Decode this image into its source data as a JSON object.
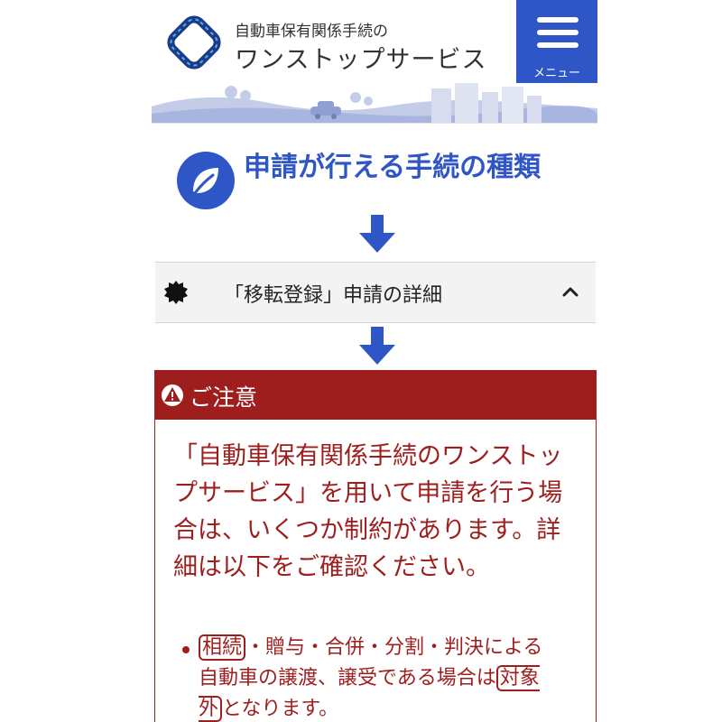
{
  "header": {
    "brand_line1": "自動車保有関係手続の",
    "brand_line2": "ワンストップサービス",
    "menu_label": "メニュー"
  },
  "section": {
    "title": "申請が行える手続の種類"
  },
  "accordion": {
    "label": "「移転登録」申請の詳細"
  },
  "notice": {
    "title": "ご注意",
    "body": "「自動車保有関係手続のワンストップサービス」を用いて申請を行う場合は、いくつか制約があります。詳細は以下をご確認ください。",
    "bullet": {
      "highlight1": "相続",
      "middle": "・贈与・合併・分割・判決による自動車の譲渡、譲受である場合は",
      "highlight2": "対象外",
      "end": "となります。"
    }
  },
  "colors": {
    "primary_blue": "#2f56c6",
    "notice_red": "#9e1e1e"
  },
  "icons": {
    "logo": "rounded-diamond-road-logo",
    "menu": "hamburger-icon",
    "section": "leaf-icon",
    "arrow": "down-arrow-icon",
    "accordion": "gear-seal-icon",
    "chevron": "chevron-up-icon",
    "warning": "warning-icon"
  }
}
